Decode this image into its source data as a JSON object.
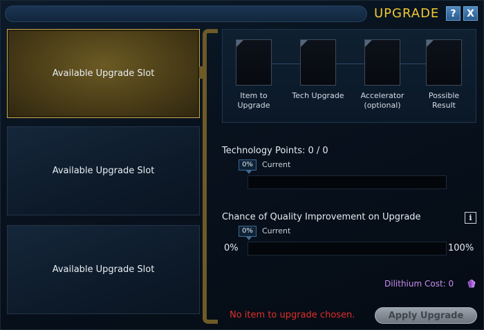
{
  "window": {
    "title": "UPGRADE",
    "help_label": "?",
    "close_label": "X"
  },
  "slots": [
    {
      "label": "Available Upgrade Slot",
      "selected": true
    },
    {
      "label": "Available Upgrade Slot",
      "selected": false
    },
    {
      "label": "Available Upgrade Slot",
      "selected": false
    }
  ],
  "workflow": {
    "steps": [
      {
        "label": "Item to Upgrade"
      },
      {
        "label": "Tech Upgrade"
      },
      {
        "label": "Accelerator (optional)"
      },
      {
        "label": "Possible Result"
      }
    ]
  },
  "tech_points": {
    "title": "Technology Points: 0 / 0",
    "badge": "0%",
    "current_label": "Current",
    "progress_fraction": 0
  },
  "quality": {
    "title": "Chance of Quality Improvement on Upgrade",
    "badge": "0%",
    "current_label": "Current",
    "min_label": "0%",
    "max_label": "100%",
    "info_label": "i",
    "progress_fraction": 0
  },
  "cost": {
    "text": "Dilithium Cost: 0",
    "icon": "dilithium-crystal-icon"
  },
  "status": {
    "error": "No item to upgrade chosen."
  },
  "actions": {
    "apply_label": "Apply Upgrade",
    "apply_enabled": false
  },
  "colors": {
    "title": "#f2c932",
    "error": "#e0302a",
    "cost": "#c78ef0",
    "selected_border": "#c9a948"
  }
}
